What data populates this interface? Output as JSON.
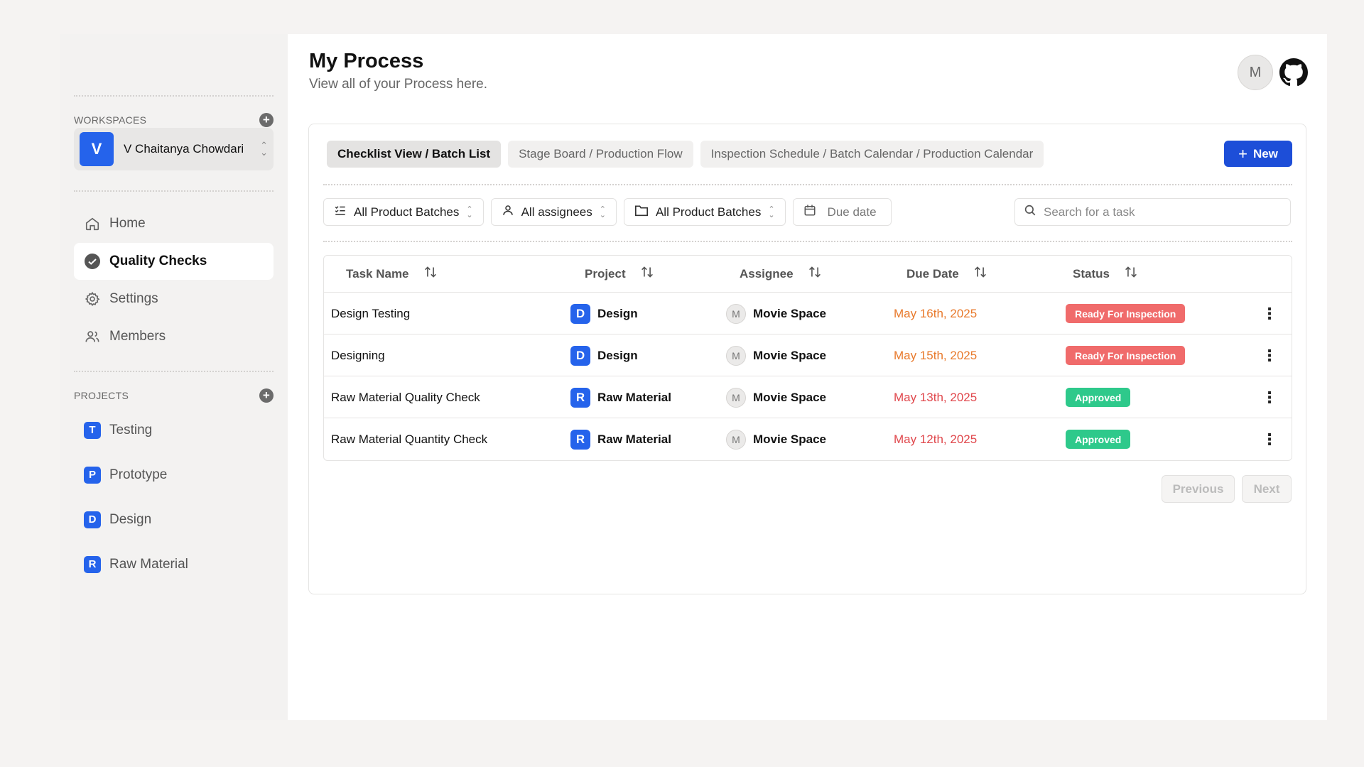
{
  "sidebar": {
    "workspaces_label": "WORKSPACES",
    "workspace": {
      "initial": "V",
      "name": "V Chaitanya Chowdari"
    },
    "nav": [
      {
        "label": "Home",
        "icon": "home-icon"
      },
      {
        "label": "Quality Checks",
        "icon": "check-circle-icon",
        "active": true
      },
      {
        "label": "Settings",
        "icon": "gear-icon"
      },
      {
        "label": "Members",
        "icon": "users-icon"
      }
    ],
    "projects_label": "PROJECTS",
    "projects": [
      {
        "initial": "T",
        "label": "Testing"
      },
      {
        "initial": "P",
        "label": "Prototype"
      },
      {
        "initial": "D",
        "label": "Design"
      },
      {
        "initial": "R",
        "label": "Raw Material"
      }
    ]
  },
  "header": {
    "title": "My Process",
    "subtitle": "View all of your Process here.",
    "avatar_initial": "M"
  },
  "tabs": [
    {
      "label": "Checklist View / Batch List",
      "active": true
    },
    {
      "label": "Stage Board / Production Flow"
    },
    {
      "label": "Inspection Schedule / Batch Calendar / Production Calendar"
    }
  ],
  "new_button": "New",
  "filters": {
    "batches1": "All Product Batches",
    "assignees": "All assignees",
    "batches2": "All Product Batches",
    "due_date": "Due date",
    "search_placeholder": "Search for a task"
  },
  "table": {
    "columns": [
      "Task Name",
      "Project",
      "Assignee",
      "Due Date",
      "Status"
    ],
    "rows": [
      {
        "task": "Design Testing",
        "project_initial": "D",
        "project": "Design",
        "assignee_initial": "M",
        "assignee": "Movie Space",
        "due": "May 16th, 2025",
        "due_color": "#e8792b",
        "status": "Ready For Inspection",
        "status_color": "#f06b6b"
      },
      {
        "task": "Designing",
        "project_initial": "D",
        "project": "Design",
        "assignee_initial": "M",
        "assignee": "Movie Space",
        "due": "May 15th, 2025",
        "due_color": "#e8792b",
        "status": "Ready For Inspection",
        "status_color": "#f06b6b"
      },
      {
        "task": "Raw Material Quality Check",
        "project_initial": "R",
        "project": "Raw Material",
        "assignee_initial": "M",
        "assignee": "Movie Space",
        "due": "May 13th, 2025",
        "due_color": "#e0474c",
        "status": "Approved",
        "status_color": "#2ec98b"
      },
      {
        "task": "Raw Material Quantity Check",
        "project_initial": "R",
        "project": "Raw Material",
        "assignee_initial": "M",
        "assignee": "Movie Space",
        "due": "May 12th, 2025",
        "due_color": "#e0474c",
        "status": "Approved",
        "status_color": "#2ec98b"
      }
    ]
  },
  "pager": {
    "previous": "Previous",
    "next": "Next"
  },
  "colors": {
    "accent": "#2563eb",
    "primary_button": "#1d4ed8"
  }
}
